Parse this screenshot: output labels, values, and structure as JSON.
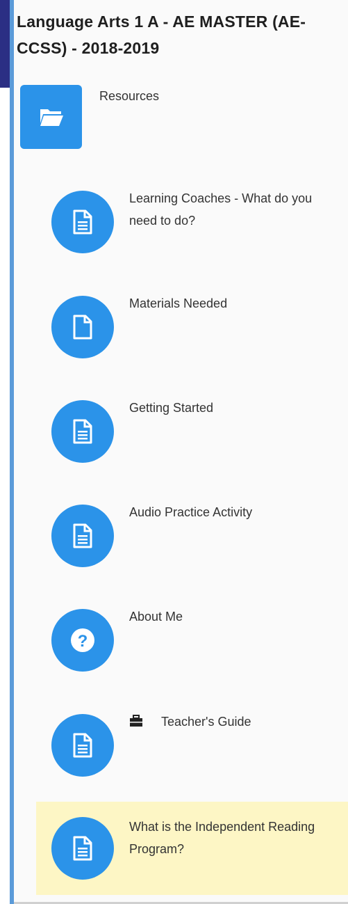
{
  "course": {
    "title": "Language Arts 1 A - AE MASTER (AE-CCSS) - 2018-2019"
  },
  "section": {
    "label": "Resources",
    "icon": "folder-open-icon"
  },
  "activities": [
    {
      "label": "Learning Coaches - What do you need to do?",
      "icon": "document-icon"
    },
    {
      "label": "Materials Needed",
      "icon": "blank-file-icon"
    },
    {
      "label": "Getting Started",
      "icon": "document-icon"
    },
    {
      "label": "Audio Practice Activity",
      "icon": "document-icon"
    },
    {
      "label": "About Me",
      "icon": "question-icon"
    },
    {
      "label": "Teacher's Guide",
      "icon": "document-icon",
      "badge_icon": "briefcase-icon"
    },
    {
      "label": "What is the Independent Reading Program?",
      "icon": "document-icon",
      "highlighted": true
    }
  ],
  "colors": {
    "accent": "#2b93e9",
    "rail": "#5b9bd9",
    "corner": "#2b2f84",
    "highlight": "#fdf6c5"
  }
}
